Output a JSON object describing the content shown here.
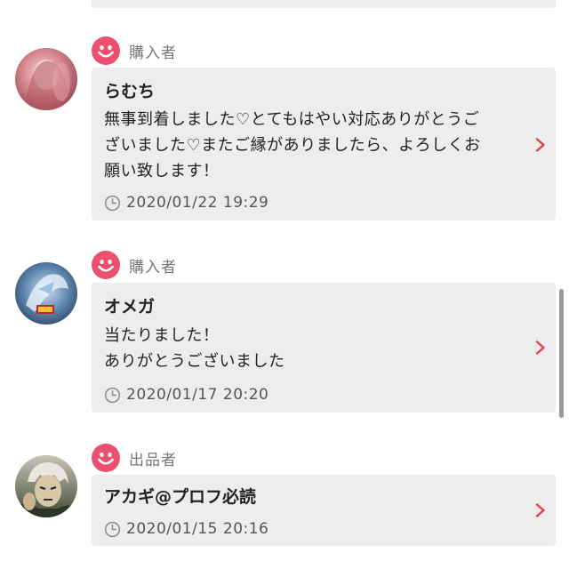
{
  "reviews": [
    {
      "role": "購入者",
      "username": "らむち",
      "message": "無事到着しました♡とてもはやい対応ありがとうご\nざいました♡またご縁がありましたら、よろしくお\n願い致します！",
      "timestamp": "2020/01/22 19:29"
    },
    {
      "role": "購入者",
      "username": "オメガ",
      "message": "当たりました！\nありがとうございました",
      "timestamp": "2020/01/17 20:20"
    },
    {
      "role": "出品者",
      "username": "アカギ@プロフ必読",
      "message": "",
      "timestamp": "2020/01/15 20:16"
    }
  ],
  "colors": {
    "accent": "#ec4f6f",
    "card_background": "#ededed",
    "role_text": "#777777",
    "chevron": "#e0424e"
  },
  "icons": {
    "role_badge": "smile-face-icon",
    "time": "clock-icon",
    "open": "chevron-right-icon"
  }
}
